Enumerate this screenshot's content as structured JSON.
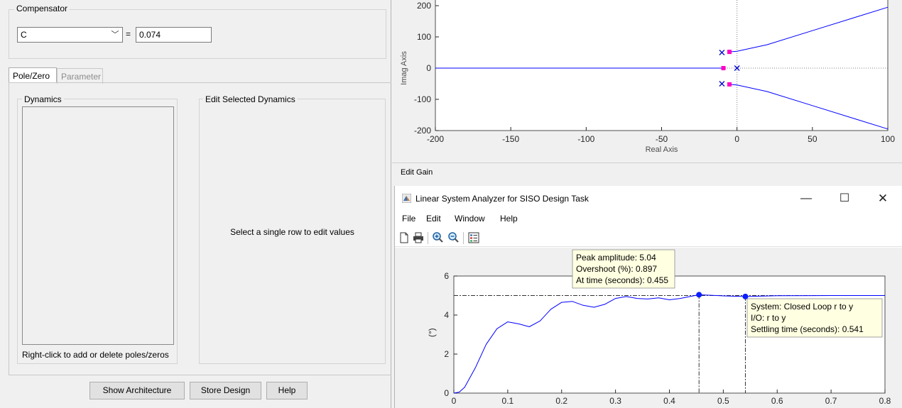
{
  "compensator": {
    "title": "Compensator",
    "selected": "C",
    "equals": "=",
    "gain": "0.074"
  },
  "tabs": [
    {
      "label": "Pole/Zero",
      "active": true
    },
    {
      "label": "Parameter",
      "active": false
    }
  ],
  "dynamics": {
    "title": "Dynamics",
    "hint": "Right-click to add or delete poles/zeros"
  },
  "edit_dynamics": {
    "title": "Edit Selected Dynamics",
    "message": "Select a single row to edit values"
  },
  "buttons": {
    "show_architecture": "Show Architecture",
    "store_design": "Store Design",
    "help": "Help"
  },
  "root_locus": {
    "ylabel": "Imag Axis",
    "xlabel": "Real Axis",
    "edit_gain": "Edit Gain"
  },
  "lsa_window": {
    "title": "Linear System Analyzer for SISO Design Task",
    "controls": {
      "minimize": "—",
      "maximize": "☐",
      "close": "✕"
    },
    "menu": [
      "File",
      "Edit",
      "Window",
      "Help"
    ],
    "toolbar_icons": [
      "new-document-icon",
      "print-icon",
      "zoom-in-icon",
      "zoom-out-icon",
      "legend-icon"
    ]
  },
  "step_response": {
    "ylabel": "(°)",
    "datatip_peak": [
      "Peak amplitude: 5.04",
      "Overshoot (%): 0.897",
      "At time (seconds): 0.455"
    ],
    "datatip_settling": [
      "System: Closed Loop r to y",
      "I/O: r to y",
      "Settling time (seconds): 0.541"
    ]
  },
  "chart_data": [
    {
      "type": "scatter",
      "title": "",
      "xlabel": "Real Axis",
      "ylabel": "Imag Axis",
      "xlim": [
        -200,
        100
      ],
      "ylim": [
        -200,
        200
      ],
      "xticks": [
        -200,
        -150,
        -100,
        -50,
        0,
        50,
        100
      ],
      "yticks": [
        -200,
        -100,
        0,
        100,
        200
      ],
      "poles": [
        [
          -10,
          50
        ],
        [
          -10,
          -50
        ],
        [
          0,
          0
        ]
      ],
      "closed_loop_poles": [
        [
          -5,
          52
        ],
        [
          -5,
          -52
        ],
        [
          -9,
          0
        ]
      ],
      "branches": [
        {
          "x": [
            -5,
            0,
            20,
            50,
            80,
            100
          ],
          "y": [
            52,
            54,
            75,
            120,
            165,
            195
          ]
        },
        {
          "x": [
            -5,
            0,
            20,
            50,
            80,
            100
          ],
          "y": [
            -52,
            -54,
            -75,
            -120,
            -165,
            -195
          ]
        },
        {
          "x": [
            -200,
            -9
          ],
          "y": [
            0,
            0
          ]
        }
      ],
      "colors": {
        "locus": "#0000ff",
        "closed_loop": "#ff00c8",
        "pole": "#0000d0"
      }
    },
    {
      "type": "line",
      "title": "",
      "xlabel": "",
      "ylabel": "(°)",
      "xlim": [
        0,
        0.8
      ],
      "ylim": [
        0,
        6
      ],
      "xticks": [
        0,
        0.1,
        0.2,
        0.3,
        0.4,
        0.5,
        0.6,
        0.7,
        0.8
      ],
      "yticks": [
        0,
        2,
        4,
        6
      ],
      "series": [
        {
          "x": [
            0,
            0.01,
            0.02,
            0.04,
            0.06,
            0.08,
            0.1,
            0.12,
            0.14,
            0.16,
            0.18,
            0.2,
            0.22,
            0.24,
            0.26,
            0.28,
            0.3,
            0.32,
            0.34,
            0.36,
            0.38,
            0.4,
            0.42,
            0.455,
            0.5,
            0.541,
            0.6,
            0.7,
            0.8
          ],
          "y": [
            0,
            0.05,
            0.3,
            1.3,
            2.5,
            3.3,
            3.65,
            3.55,
            3.4,
            3.7,
            4.3,
            4.65,
            4.7,
            4.5,
            4.4,
            4.55,
            4.85,
            4.95,
            4.85,
            4.82,
            4.88,
            4.78,
            4.85,
            5.04,
            4.98,
            4.95,
            4.99,
            5.0,
            5.0
          ]
        }
      ],
      "final_value": 5.0,
      "markers": [
        {
          "x": 0.455,
          "y": 5.04
        },
        {
          "x": 0.541,
          "y": 4.95
        }
      ],
      "color": "#0000ff"
    }
  ]
}
